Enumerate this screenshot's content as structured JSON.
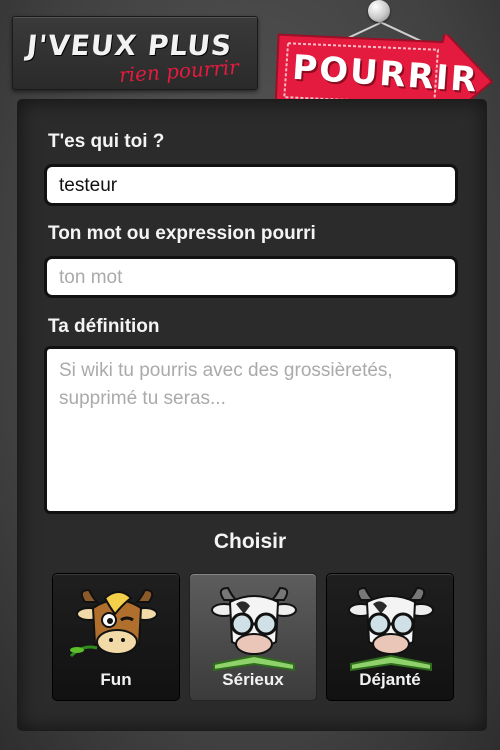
{
  "logo": {
    "line1": "J'VEUX PLUS",
    "line2": "rien pourrir"
  },
  "action": {
    "label": "POURRIR",
    "color": "#e41b3f"
  },
  "form": {
    "name_label": "T'es qui toi ?",
    "name_value": "testeur",
    "word_label": "Ton mot ou expression pourri",
    "word_placeholder": "ton mot",
    "definition_label": "Ta définition",
    "definition_placeholder": "Si wiki tu pourris avec des grossièretés, supprimé tu seras..."
  },
  "choice": {
    "title": "Choisir",
    "options": [
      {
        "label": "Fun",
        "icon": "cow-fun-icon",
        "selected": false
      },
      {
        "label": "Sérieux",
        "icon": "cow-glasses-icon",
        "selected": true
      },
      {
        "label": "Déjanté",
        "icon": "cow-glasses-icon",
        "selected": false
      }
    ]
  }
}
